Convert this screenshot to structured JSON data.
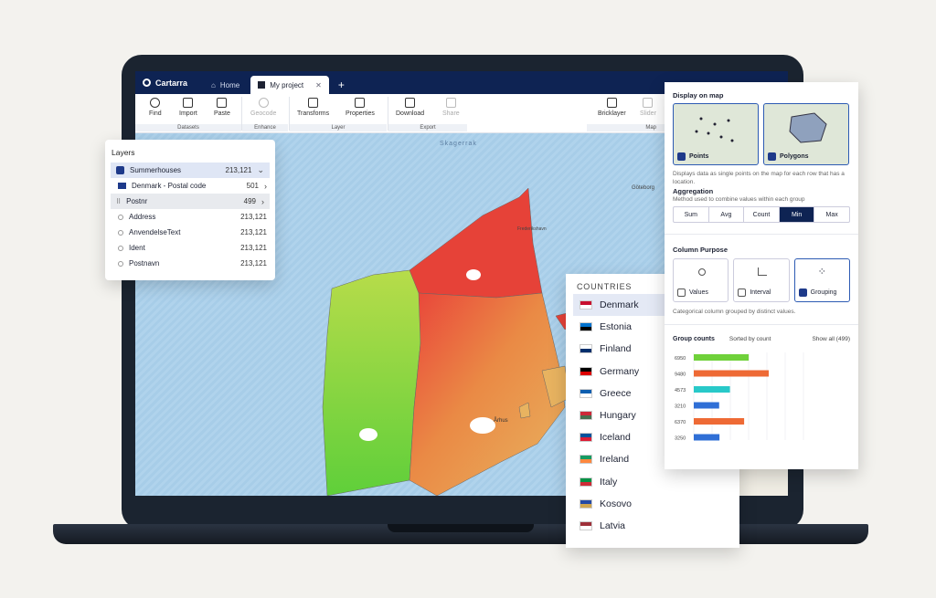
{
  "app": {
    "brand": "Cartarra"
  },
  "tabs": [
    {
      "label": "Home"
    },
    {
      "label": "My project"
    }
  ],
  "toolbar": {
    "find": "Find",
    "import": "Import",
    "paste": "Paste",
    "geocode": "Geocode",
    "transforms": "Transforms",
    "properties": "Properties",
    "download": "Download",
    "share": "Share",
    "bricklayer": "Bricklayer",
    "slider": "Slider",
    "groups": {
      "datasets": "Datasets",
      "enhance": "Enhance",
      "layer": "Layer",
      "export": "Export",
      "map": "Map"
    }
  },
  "map": {
    "labels": {
      "skagerrak": "Skagerrak",
      "goteborg": "Göteborg",
      "aarhus": "Århus",
      "frederikshavn": "Frederikshavn"
    }
  },
  "layers": {
    "title": "Layers",
    "group": {
      "name": "Summerhouses",
      "count": "213,121"
    },
    "items": [
      {
        "name": "Denmark - Postal code",
        "count": "501"
      },
      {
        "name": "Postnr",
        "count": "499"
      },
      {
        "name": "Address",
        "count": "213,121"
      },
      {
        "name": "AnvendelseText",
        "count": "213,121"
      },
      {
        "name": "Ident",
        "count": "213,121"
      },
      {
        "name": "Postnavn",
        "count": "213,121"
      }
    ]
  },
  "countries": {
    "title": "COUNTRIES",
    "items": [
      "Denmark",
      "Estonia",
      "Finland",
      "Germany",
      "Greece",
      "Hungary",
      "Iceland",
      "Ireland",
      "Italy",
      "Kosovo",
      "Latvia"
    ]
  },
  "props": {
    "display_title": "Display on map",
    "points": "Points",
    "polygons": "Polygons",
    "display_desc": "Displays data as single points on the map for each row that has a location.",
    "agg_title": "Aggregation",
    "agg_desc": "Method used to combine values within each group",
    "agg_options": [
      "Sum",
      "Avg",
      "Count",
      "Min",
      "Max"
    ],
    "agg_selected": "Min",
    "purpose_title": "Column Purpose",
    "purpose": [
      "Values",
      "Interval",
      "Grouping"
    ],
    "purpose_desc": "Categorical column grouped by distinct values.",
    "group_counts": "Group counts",
    "sorted_by": "Sorted by count",
    "show_all": "Show all (499)",
    "bars": [
      {
        "label": "6950",
        "value": 6950,
        "color": "#6fd13a"
      },
      {
        "label": "9480",
        "value": 9480,
        "color": "#ee6a35"
      },
      {
        "label": "4573",
        "value": 4573,
        "color": "#28c9c9"
      },
      {
        "label": "3210",
        "value": 3210,
        "color": "#2f6fd6"
      },
      {
        "label": "6370",
        "value": 6370,
        "color": "#ee6a35"
      },
      {
        "label": "3250",
        "value": 3250,
        "color": "#2f6fd6"
      }
    ]
  }
}
